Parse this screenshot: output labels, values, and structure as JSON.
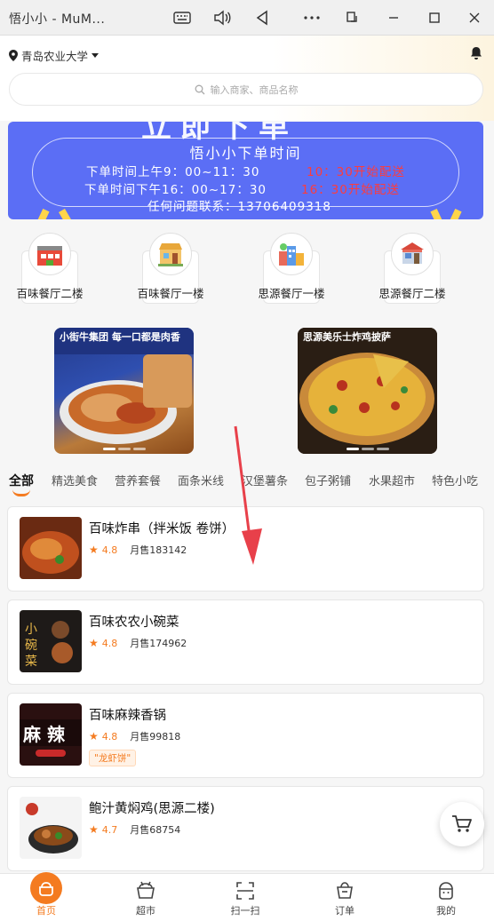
{
  "window": {
    "title": "悟小小 - MuM...",
    "controls": [
      "keyboard-icon",
      "volume-icon",
      "back-icon",
      "more-icon",
      "rotate-icon",
      "minimize-icon",
      "maximize-icon",
      "close-icon"
    ]
  },
  "header": {
    "location": "青岛农业大学",
    "search_placeholder": "输入商家、商品名称"
  },
  "banner": {
    "big_text": "立即下单",
    "title": "悟小小下单时间",
    "line1_a": "下单时间上午9：00~11：30",
    "line1_b": "10：30开始配送",
    "line2_a": "下单时间下午16：00~17：30",
    "line2_b": "16：30开始配送",
    "line3": "任何问题联系：13706409318"
  },
  "categories": [
    {
      "label": "百味餐厅二楼",
      "icon": "restaurant-building-icon"
    },
    {
      "label": "百味餐厅一楼",
      "icon": "shop-building-icon"
    },
    {
      "label": "思源餐厅一楼",
      "icon": "town-buildings-icon"
    },
    {
      "label": "思源餐厅二楼",
      "icon": "store-front-icon"
    }
  ],
  "promos": [
    {
      "text": "小街牛集团 每一口都是肉香"
    },
    {
      "text": "思源美乐士炸鸡披萨"
    }
  ],
  "tabs": [
    "全部",
    "精选美食",
    "营养套餐",
    "面条米线",
    "汉堡薯条",
    "包子粥铺",
    "水果超市",
    "特色小吃"
  ],
  "stores": [
    {
      "name": "百味炸串（拌米饭 卷饼）",
      "rating": "4.8",
      "sales": "月售183142",
      "tag": ""
    },
    {
      "name": "百味农农小碗菜",
      "rating": "4.8",
      "sales": "月售174962",
      "tag": ""
    },
    {
      "name": "百味麻辣香锅",
      "rating": "4.8",
      "sales": "月售99818",
      "tag": "\"龙虾饼\"",
      "thumb_text": "麻 辣"
    },
    {
      "name": "鲍汁黄焖鸡(思源二楼)",
      "rating": "4.7",
      "sales": "月售68754",
      "tag": ""
    }
  ],
  "bottom_nav": [
    {
      "label": "首页",
      "icon": "home-icon",
      "active": true
    },
    {
      "label": "超市",
      "icon": "supermarket-icon",
      "active": false
    },
    {
      "label": "扫一扫",
      "icon": "scan-icon",
      "active": false
    },
    {
      "label": "订单",
      "icon": "order-icon",
      "active": false
    },
    {
      "label": "我的",
      "icon": "profile-icon",
      "active": false
    }
  ],
  "colors": {
    "accent": "#f47b20",
    "banner": "#5b6ef5",
    "banner_red": "#ff3b3b"
  }
}
